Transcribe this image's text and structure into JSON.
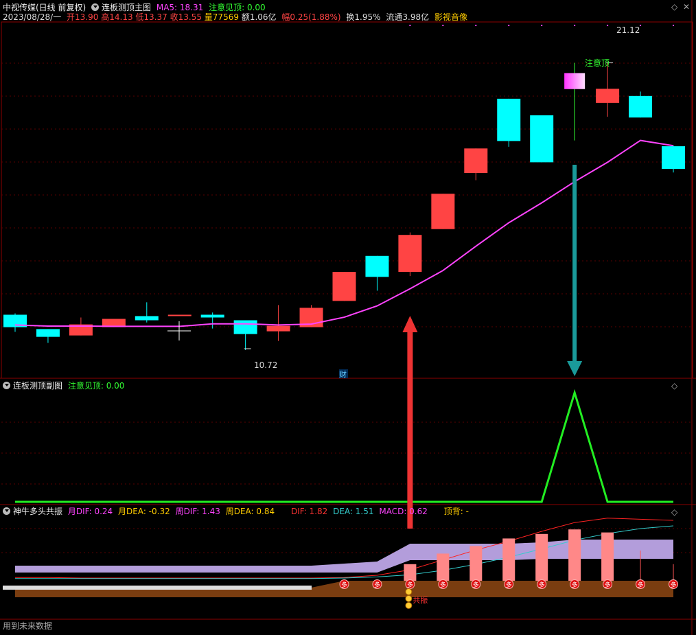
{
  "header": {
    "stock_name": "中视传媒(日线 前复权)",
    "main_indicator": "连板测顶主图",
    "ma5_label": "MA5: 18.31",
    "ma5_color": "#ff44ff",
    "notice_label": "注意见顶: 0.00",
    "notice_color": "#33ff33",
    "date": "2023/08/28/一",
    "open": "开13.90",
    "high": "高14.13",
    "low": "低13.37",
    "close": "收13.55",
    "volume": "量77569",
    "amount": "额1.06亿",
    "change": "幅0.25(1.88%)",
    "turnover": "换1.95%",
    "float": "流通3.98亿",
    "sector": "影视音像",
    "close_icon": "close-icon",
    "maximize_icon": "diamond-icon"
  },
  "sub1": {
    "title": "连板测顶副图",
    "notice_label": "注意见顶: 0.00"
  },
  "sub2": {
    "title": "神牛多头共振",
    "month_dif": "月DIF: 0.24",
    "month_dea": "月DEA: -0.32",
    "week_dif": "周DIF: 1.43",
    "week_dea": "周DEA: 0.84",
    "dif": "DIF: 1.82",
    "dea": "DEA: 1.51",
    "macd": "MACD: 0.62",
    "top_div": "顶背: -",
    "duo_label": "多",
    "gongzhen_label": "共振"
  },
  "footer": {
    "future_data": "用到未来数据"
  },
  "annotations": {
    "low_label": "10.72",
    "high_label": "21.12",
    "top_warning": "注意顶",
    "cai": "财"
  },
  "colors": {
    "up": "#ff4444",
    "down": "#00ffff",
    "ma5": "#ff44ff",
    "sub1_line": "#22ee22",
    "purple_band": "#b39ddb",
    "brown_band": "#7a3d10",
    "macd_bar": "#ff8888",
    "dif_line": "#ff2222",
    "dea_line": "#33cccc"
  },
  "chart_data": [
    {
      "type": "candlestick",
      "title": "连板测顶主图",
      "ylim": [
        9.7,
        22.6
      ],
      "candles": [
        {
          "o": 12.0,
          "c": 11.55,
          "h": 12.05,
          "l": 11.38
        },
        {
          "o": 11.48,
          "c": 11.2,
          "h": 11.48,
          "l": 10.98
        },
        {
          "o": 11.25,
          "c": 11.65,
          "h": 11.9,
          "l": 11.25
        },
        {
          "o": 11.55,
          "c": 11.85,
          "h": 11.85,
          "l": 11.55
        },
        {
          "o": 11.95,
          "c": 11.8,
          "h": 12.45,
          "l": 11.72
        },
        {
          "o": 12.0,
          "c": 12.0,
          "h": 12.0,
          "l": 12.0
        },
        {
          "o": 12.0,
          "c": 11.9,
          "h": 12.08,
          "l": 11.5
        },
        {
          "o": 11.8,
          "c": 11.3,
          "h": 11.8,
          "l": 10.72
        },
        {
          "o": 11.4,
          "c": 11.6,
          "h": 12.35,
          "l": 11.05
        },
        {
          "o": 11.55,
          "c": 12.25,
          "h": 12.35,
          "l": 11.55
        },
        {
          "o": 12.5,
          "c": 13.55,
          "h": 13.55,
          "l": 12.5
        },
        {
          "o": 14.13,
          "c": 13.37,
          "h": 14.13,
          "l": 12.87
        },
        {
          "o": 13.55,
          "c": 14.89,
          "h": 14.98,
          "l": 13.4
        },
        {
          "o": 15.1,
          "c": 16.38,
          "h": 16.38,
          "l": 15.1
        },
        {
          "o": 17.13,
          "c": 18.02,
          "h": 18.02,
          "l": 16.87
        },
        {
          "o": 19.82,
          "c": 18.29,
          "h": 19.82,
          "l": 18.08
        },
        {
          "o": 19.22,
          "c": 17.52,
          "h": 19.22,
          "l": 17.52
        },
        {
          "o": 20.75,
          "c": 20.17,
          "h": 21.12,
          "l": 18.31
        },
        {
          "o": 19.67,
          "c": 20.18,
          "h": 21.12,
          "l": 19.17
        },
        {
          "o": 19.92,
          "c": 19.14,
          "h": 20.08,
          "l": 19.14
        },
        {
          "o": 18.1,
          "c": 17.28,
          "h": 18.13,
          "l": 17.15
        }
      ],
      "ma5": [
        11.63,
        11.59,
        11.59,
        11.58,
        11.58,
        11.58,
        11.67,
        11.67,
        11.63,
        11.66,
        11.91,
        12.32,
        12.94,
        13.6,
        14.48,
        15.33,
        16.05,
        16.82,
        17.52,
        18.31,
        18.12
      ],
      "special_candle": 17,
      "low_marker": {
        "index": 7,
        "value": 10.72
      },
      "high_marker": {
        "index": 18,
        "value": 21.12
      }
    },
    {
      "type": "line",
      "title": "连板测顶副图",
      "series": [
        {
          "values": [
            0,
            0,
            0,
            0,
            0,
            0,
            0,
            0,
            0,
            0,
            0,
            0,
            0,
            0,
            0,
            0,
            0,
            1,
            0,
            0,
            0
          ]
        }
      ]
    },
    {
      "type": "bar",
      "title": "神牛多头共振",
      "macd": [
        0,
        0,
        0,
        0,
        0,
        0,
        0,
        0,
        0,
        0,
        0,
        0,
        0.22,
        0.36,
        0.46,
        0.56,
        0.62,
        0.68,
        0.64,
        0.4,
        0.22
      ],
      "dif": [
        0.06,
        0.06,
        0.05,
        0.05,
        0.05,
        0.05,
        0.05,
        0.05,
        0.05,
        0.05,
        0.06,
        0.1,
        0.2,
        0.38,
        0.56,
        0.72,
        0.9,
        1.06,
        1.14,
        1.12,
        1.1
      ],
      "dea": [
        0.04,
        0.04,
        0.04,
        0.04,
        0.04,
        0.04,
        0.04,
        0.04,
        0.04,
        0.04,
        0.05,
        0.07,
        0.11,
        0.19,
        0.3,
        0.43,
        0.58,
        0.74,
        0.86,
        0.95,
        1.0
      ],
      "duo_start": 10,
      "gongzhen_index": 12
    }
  ]
}
